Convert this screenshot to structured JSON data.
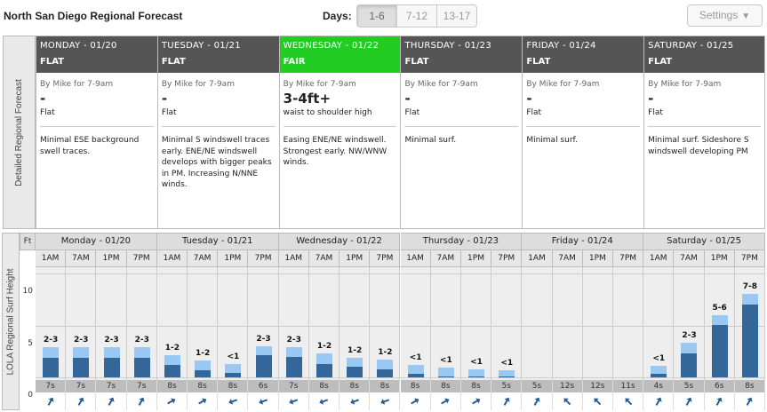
{
  "header": {
    "title": "North San Diego Regional Forecast",
    "days_label": "Days:",
    "day_ranges": [
      "1-6",
      "7-12",
      "13-17"
    ],
    "active_range": "1-6",
    "settings_label": "Settings"
  },
  "forecast": {
    "side_label": "Detailed Regional Forecast",
    "days": [
      {
        "date": "MONDAY - 01/20",
        "rating": "FLAT",
        "by": "By Mike for 7-9am",
        "height": "-",
        "condition": "Flat",
        "notes": "Minimal ESE background swell traces.",
        "highlight": false
      },
      {
        "date": "TUESDAY - 01/21",
        "rating": "FLAT",
        "by": "By Mike for 7-9am",
        "height": "-",
        "condition": "Flat",
        "notes": "Minimal S windswell traces early. ENE/NE windswell develops with bigger peaks in PM. Increasing N/NNE winds.",
        "highlight": false
      },
      {
        "date": "WEDNESDAY - 01/22",
        "rating": "FAIR",
        "by": "By Mike for 7-9am",
        "height": "3-4ft+",
        "condition": "waist to shoulder high",
        "notes": "Easing ENE/NE windswell. Strongest early. NW/WNW winds.",
        "highlight": true
      },
      {
        "date": "THURSDAY - 01/23",
        "rating": "FLAT",
        "by": "By Mike for 7-9am",
        "height": "-",
        "condition": "Flat",
        "notes": "Minimal surf.",
        "highlight": false
      },
      {
        "date": "FRIDAY - 01/24",
        "rating": "FLAT",
        "by": "By Mike for 7-9am",
        "height": "-",
        "condition": "Flat",
        "notes": "Minimal surf.",
        "highlight": false
      },
      {
        "date": "SATURDAY - 01/25",
        "rating": "FLAT",
        "by": "By Mike for 7-9am",
        "height": "-",
        "condition": "Flat",
        "notes": "Minimal surf. Sideshore S windswell developing PM",
        "highlight": false
      }
    ]
  },
  "chart_side_label": "LOLA Regional Surf Height",
  "chart_data": {
    "type": "bar",
    "ylabel": "Ft",
    "ylim": [
      0,
      10
    ],
    "yticks": [
      0,
      5,
      10
    ],
    "grid": true,
    "days": [
      "Monday - 01/20",
      "Tuesday - 01/21",
      "Wednesday - 01/22",
      "Thursday - 01/23",
      "Friday - 01/24",
      "Saturday - 01/25"
    ],
    "hours": [
      "1AM",
      "7AM",
      "1PM",
      "7PM"
    ],
    "series": [
      {
        "name": "min",
        "values": [
          1.9,
          1.9,
          1.9,
          1.9,
          1.2,
          0.7,
          0.4,
          2.1,
          2.0,
          1.3,
          1.0,
          0.8,
          0.3,
          0.1,
          0.1,
          0.1,
          0,
          0,
          0,
          0,
          0.3,
          2.3,
          5.0,
          7.0
        ]
      },
      {
        "name": "max",
        "values": [
          2.9,
          2.9,
          2.9,
          2.9,
          2.1,
          1.6,
          1.3,
          3.0,
          2.9,
          2.3,
          1.9,
          1.7,
          1.2,
          0.9,
          0.8,
          0.7,
          0,
          0,
          0,
          0,
          1.1,
          3.3,
          6.0,
          8.0
        ]
      }
    ],
    "labels": [
      "2-3",
      "2-3",
      "2-3",
      "2-3",
      "1-2",
      "1-2",
      "<1",
      "2-3",
      "2-3",
      "1-2",
      "1-2",
      "1-2",
      "<1",
      "<1",
      "<1",
      "<1",
      "",
      "",
      "",
      "",
      "<1",
      "2-3",
      "5-6",
      "7-8"
    ],
    "periods": [
      "7s",
      "7s",
      "7s",
      "7s",
      "8s",
      "8s",
      "8s",
      "6s",
      "7s",
      "8s",
      "8s",
      "8s",
      "8s",
      "8s",
      "8s",
      "5s",
      "5s",
      "12s",
      "12s",
      "11s",
      "4s",
      "5s",
      "6s",
      "8s"
    ],
    "swell_dir_deg": [
      30,
      30,
      30,
      30,
      60,
      60,
      250,
      250,
      250,
      250,
      250,
      250,
      60,
      60,
      60,
      30,
      30,
      315,
      315,
      315,
      30,
      30,
      30,
      30
    ]
  }
}
